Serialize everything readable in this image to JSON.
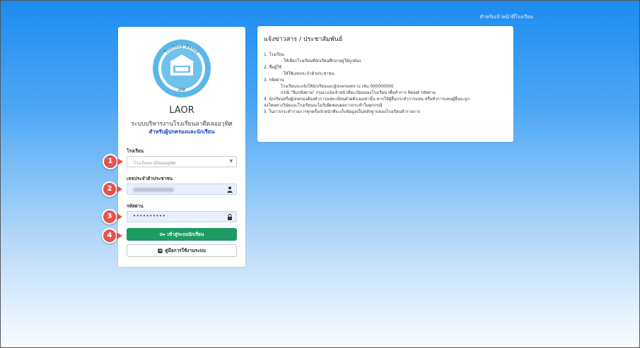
{
  "header": {
    "top_link": "สำหรับเจ้าหน้าที่โรงเรียน"
  },
  "login": {
    "app_title": "LAOR",
    "system_name": "ระบบบริหารงานโรงเรียนลาดีดลออวุทิศ",
    "audience": "สำหรับผู้ปกครองและนักเรียน",
    "school_label": "โรงเรียน",
    "school_placeholder": "โรงเรียนลาดีดลอออุทิศ",
    "id_label": "เลขประจำตัวประชาชน",
    "password_label": "รหัสผ่าน",
    "password_value": "••••••••••",
    "login_button": "เข้าสู่ระบบนักเรียน",
    "manual_button": "คู่มือการใช้งานระบบ",
    "badges": [
      "1",
      "2",
      "3",
      "4"
    ]
  },
  "news": {
    "title": "แจ้งข่าวสาร / ประชาสัมพันธ์",
    "lines": [
      "1. โรงเรียน",
      "- ให้เลือกโรงเรียนที่นักเรียนศึกษาอยู่ให้ถูกต้อง",
      "2. ชื่อผู้ใช้",
      "- ให้ใช้เลขประจำตัวประชาชน",
      "3. รหัสผ่าน",
      "โรงเรียนจะแจ้งให้นักเรียนและผู้ปกครองทราบ เช่น 000000000",
      "กรณี \"ลืมรหัสผ่าน\" กรุณาแจ้งเจ้าหน้าที่ทะเบียนของโรงเรียน เพื่อทำการ Reset รหัสผ่าน",
      "4. นักเรียนหรือผู้ปกครองต้องทำการลงทะเบียนด้วยตัวเองเท่านั้น หากให้ผู้อื่นกระทำการแทน หรือทำการแทนผู้อื่นจะถูก",
      "ลงโทษทางวินัยและโรงเรียนจะไม่รับผิดชอบผลการกระทำในทุกกรณี",
      "5. ในการกระทำรายการทุกครั้งเจ้าหน้าที่จะเก็บข้อมูลเป็นหลักฐานของโรงเรียนทำรายการ"
    ]
  },
  "logo": {
    "ring_text_top": "โรงเรียนลาดีดลออ",
    "ring_text_bottom": "อุทิศ"
  },
  "colors": {
    "login_button_bg": "#1e9b62",
    "badge_bg": "#e3544f",
    "audience_text": "#1d3fb8",
    "background_top": "#1d8cf0"
  },
  "icons": {
    "id_field": "user-icon",
    "password_field": "lock-icon",
    "login_button": "key-icon",
    "manual_button": "book-icon"
  }
}
